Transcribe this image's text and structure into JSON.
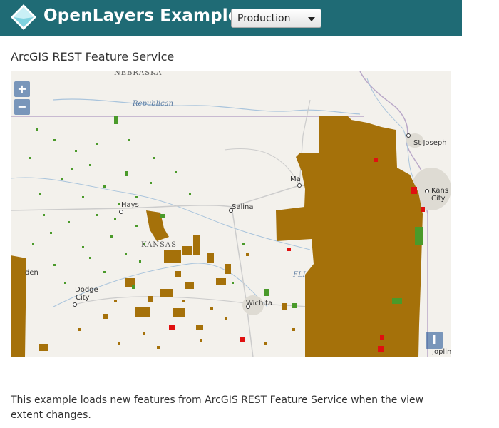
{
  "header": {
    "brand": "OpenLayers Examples",
    "version_select": "Production",
    "logo_icon": "openlayers-logo-icon"
  },
  "page": {
    "title": "ArcGIS REST Feature Service",
    "description": "This example loads new features from ArcGIS REST Feature Service when the view extent changes."
  },
  "map": {
    "controls": {
      "zoom_in": "+",
      "zoom_out": "−",
      "attribution": "i"
    },
    "labels": {
      "nebraska": "NEBRASKA",
      "republican": "Republican",
      "st_joseph": "St Joseph",
      "kansas_city_1": "Kans",
      "kansas_city_2": "City",
      "manhattan": "Ma",
      "hays": "Hays",
      "salina": "Salina",
      "kansas": "KANSAS",
      "garden": "den",
      "dodge_1": "Dodge",
      "dodge_2": "City",
      "wichita": "Wichita",
      "fli": "FLI",
      "joplin": "Joplin"
    },
    "colors": {
      "basemap": "#f3f1ec",
      "brown_features": "#a5710a",
      "green_features": "#4a9a2a",
      "red_features": "#e01010",
      "roads": "#c8c8c8",
      "rivers": "#a9c4dc",
      "state_border": "#a08ab4"
    }
  }
}
